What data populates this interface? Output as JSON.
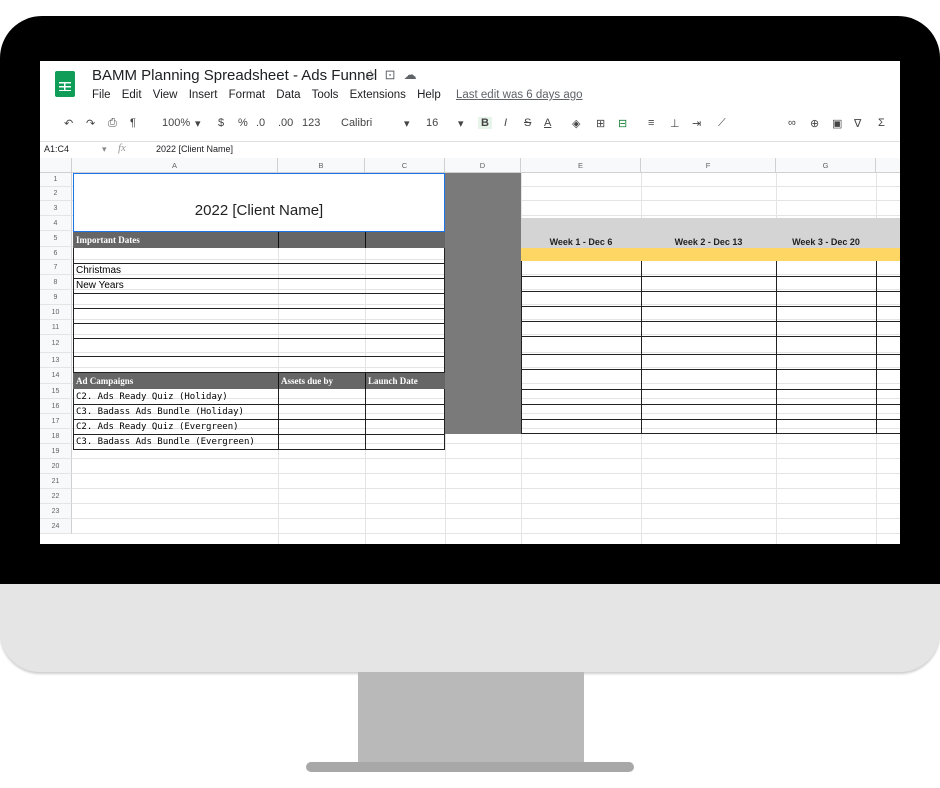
{
  "app": {
    "doc_title": "BAMM Planning Spreadsheet - Ads Funnel",
    "title_icons": [
      "star-icon",
      "move-icon",
      "cloud-icon"
    ],
    "menu": [
      "File",
      "Edit",
      "View",
      "Insert",
      "Format",
      "Data",
      "Tools",
      "Extensions",
      "Help"
    ],
    "last_edit": "Last edit was 6 days ago",
    "brand_color": "#0f9d58"
  },
  "toolbar": {
    "zoom": "100%",
    "currency": "$",
    "percent": "%",
    "dec_decrease": ".0",
    "dec_increase": ".00",
    "format": "123",
    "font": "Calibri",
    "font_size": "16",
    "bold": "B",
    "italic": "I",
    "strike": "S",
    "textcolor": "A"
  },
  "formula": {
    "range": "A1:C4",
    "fx": "fx",
    "content": "2022 [Client Name]"
  },
  "columns": [
    "A",
    "B",
    "C",
    "D",
    "E",
    "F",
    "G"
  ],
  "rows": [
    "1",
    "2",
    "3",
    "4",
    "5",
    "6",
    "7",
    "8",
    "9",
    "10",
    "11",
    "12",
    "13",
    "14",
    "15",
    "16",
    "17",
    "18",
    "19",
    "20",
    "21",
    "22",
    "23",
    "24"
  ],
  "sheet": {
    "client_title": "2022 [Client Name]",
    "important_dates_header": "Important Dates",
    "dates": [
      "Christmas",
      "New Years"
    ],
    "ad_campaigns_header": "Ad Campaigns",
    "assets_header": "Assets due by",
    "launch_header": "Launch Date",
    "campaigns": [
      "C2. Ads Ready Quiz (Holiday)",
      "C3. Badass Ads Bundle (Holiday)",
      "C2. Ads Ready Quiz (Evergreen)",
      "C3. Badass Ads Bundle (Evergreen)"
    ],
    "weeks": [
      "Week 1 - Dec 6",
      "Week 2 - Dec 13",
      "Week 3 - Dec 20"
    ],
    "header_dark": "#6d6d6d",
    "accent_yellow": "#fdd663"
  }
}
